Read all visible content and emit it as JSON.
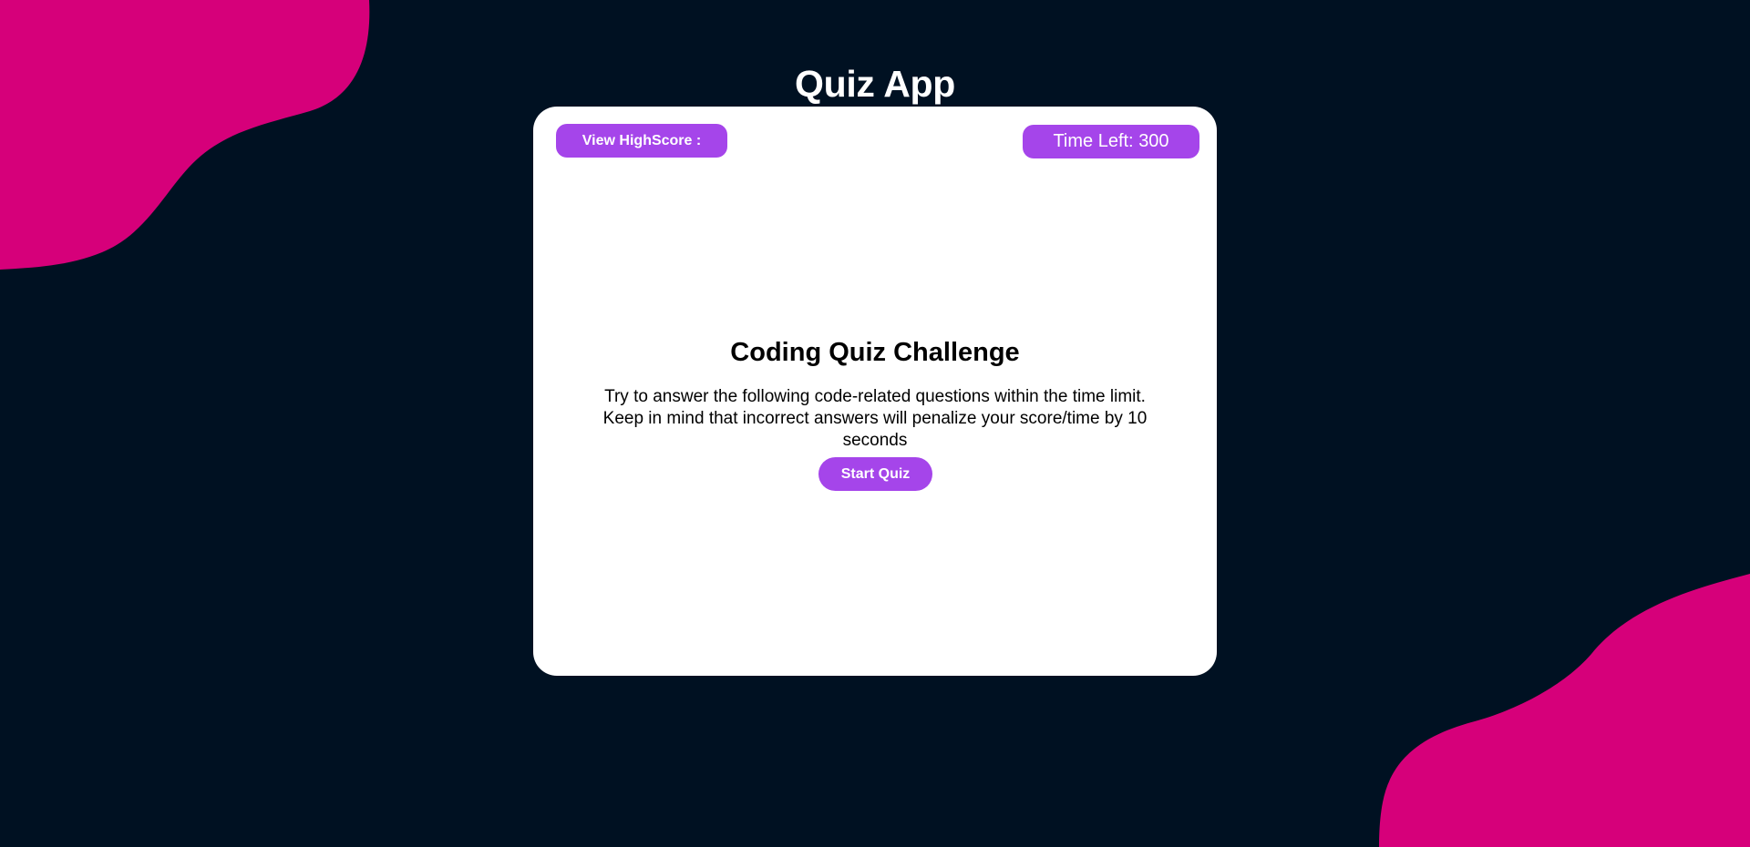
{
  "page": {
    "title": "Quiz App"
  },
  "card": {
    "highscore_button_label": "View HighScore :",
    "timer_label": "Time Left:",
    "timer_value": "300",
    "challenge_title": "Coding Quiz Challenge",
    "challenge_description": "Try to answer the following code-related questions within the time limit. Keep in mind that incorrect answers will penalize your score/time by 10 seconds",
    "start_button_label": "Start Quiz"
  },
  "colors": {
    "background": "#001122",
    "accent": "#a545ea",
    "blob": "#d6007a",
    "card": "#ffffff"
  }
}
